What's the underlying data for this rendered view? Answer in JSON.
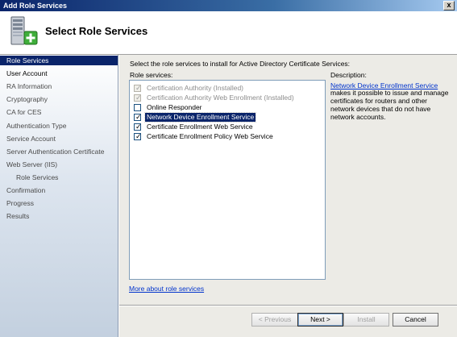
{
  "window": {
    "title": "Add Role Services",
    "close_glyph": "x"
  },
  "header": {
    "title": "Select Role Services",
    "icon": "server-add-icon"
  },
  "sidebar": {
    "items": [
      {
        "label": "Role Services",
        "state": "current"
      },
      {
        "label": "User Account",
        "state": "visited"
      },
      {
        "label": "RA Information",
        "state": "pending"
      },
      {
        "label": "Cryptography",
        "state": "pending"
      },
      {
        "label": "CA for CES",
        "state": "pending"
      },
      {
        "label": "Authentication Type",
        "state": "pending"
      },
      {
        "label": "Service Account",
        "state": "pending"
      },
      {
        "label": "Server Authentication Certificate",
        "state": "pending"
      },
      {
        "label": "Web Server (IIS)",
        "state": "pending"
      },
      {
        "label": "Role Services",
        "state": "pending"
      },
      {
        "label": "Confirmation",
        "state": "pending"
      },
      {
        "label": "Progress",
        "state": "pending"
      },
      {
        "label": "Results",
        "state": "pending"
      }
    ]
  },
  "main": {
    "intro": "Select the role services to install for Active Directory Certificate Services:",
    "roles_label": "Role services:",
    "description_label": "Description:",
    "roles": [
      {
        "label": "Certification Authority  (Installed)",
        "checked": true,
        "disabled": true
      },
      {
        "label": "Certification Authority Web Enrollment  (Installed)",
        "checked": true,
        "disabled": true
      },
      {
        "label": "Online Responder",
        "checked": false,
        "disabled": false
      },
      {
        "label": "Network Device Enrollment Service",
        "checked": true,
        "disabled": false,
        "selected": true
      },
      {
        "label": "Certificate Enrollment Web Service",
        "checked": true,
        "disabled": false
      },
      {
        "label": "Certificate Enrollment Policy Web Service",
        "checked": true,
        "disabled": false
      }
    ],
    "description_link": "Network Device Enrollment Service",
    "description_text": "makes it possible to issue and manage certificates for routers and other network devices that do not have network accounts.",
    "more_link": "More about role services"
  },
  "footer": {
    "previous": "< Previous",
    "next": "Next >",
    "install": "Install",
    "cancel": "Cancel"
  }
}
